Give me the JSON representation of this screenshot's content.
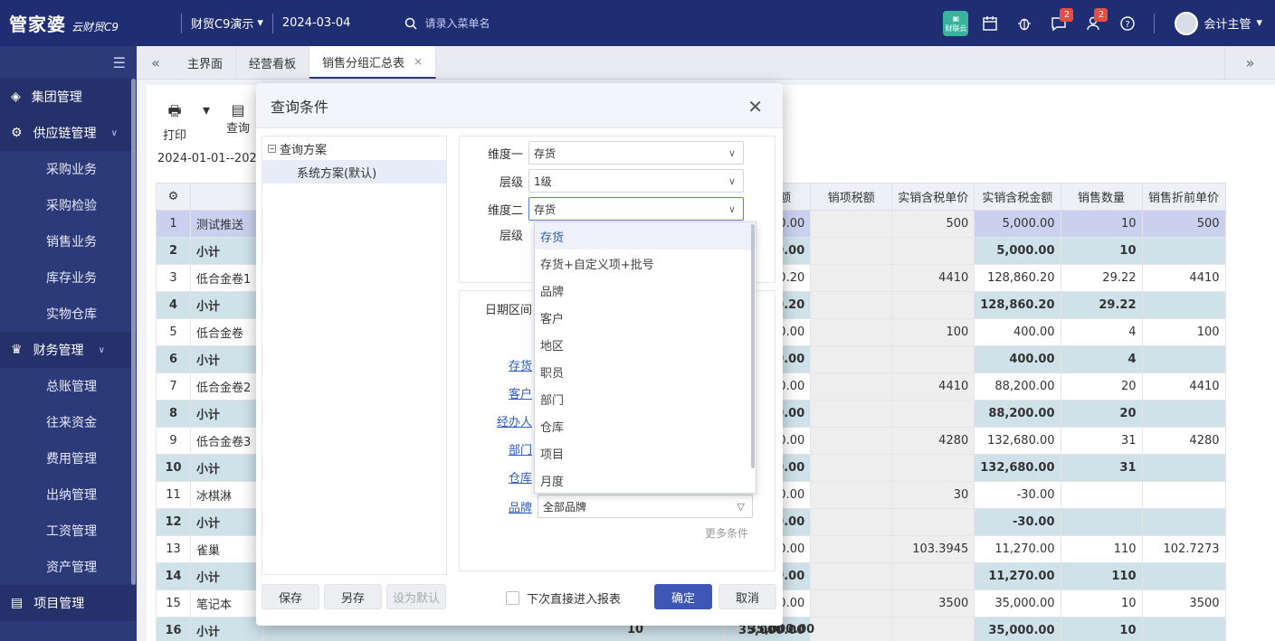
{
  "topbar": {
    "logo_main": "管家婆",
    "logo_sub": "云财贸C9",
    "account": "财贸C9演示",
    "account_caret": "▾",
    "date": "2024-03-04",
    "search_placeholder": "请录入菜单名",
    "app_badge_label": "财联云",
    "msg_badge": "2",
    "user_badge": "2",
    "user_name": "会计主管",
    "user_caret": "▾"
  },
  "sidebar": {
    "groups": [
      {
        "label": "集团管理",
        "items": []
      },
      {
        "label": "供应链管理",
        "items": [
          "采购业务",
          "采购检验",
          "销售业务",
          "库存业务",
          "实物仓库"
        ]
      },
      {
        "label": "财务管理",
        "items": [
          "总账管理",
          "往来资金",
          "费用管理",
          "出纳管理",
          "工资管理",
          "资产管理"
        ]
      },
      {
        "label": "项目管理",
        "items": []
      }
    ]
  },
  "tabs": {
    "items": [
      "主界面",
      "经营看板",
      "销售分组汇总表"
    ],
    "close": "×"
  },
  "toolbar": {
    "print": "打印",
    "query": "查询"
  },
  "report": {
    "daterange": "2024-01-01--202",
    "columns": [
      "",
      "",
      "实销金额",
      "销项税额",
      "实销含税单价",
      "实销含税金额",
      "销售数量",
      "销售折前单价"
    ],
    "rows": [
      {
        "idx": "1",
        "name": "测试推送",
        "amount": "5,000.00",
        "tax": "",
        "price": "500",
        "total": "5,000.00",
        "qty": "10",
        "pre": "500",
        "type": "sel"
      },
      {
        "idx": "2",
        "name": "小计",
        "amount": "5,000.00",
        "tax": "",
        "price": "",
        "total": "5,000.00",
        "qty": "10",
        "pre": "",
        "type": "sub"
      },
      {
        "idx": "3",
        "name": "低合金卷1",
        "amount": "128,860.20",
        "tax": "",
        "price": "4410",
        "total": "128,860.20",
        "qty": "29.22",
        "pre": "4410",
        "type": "odd"
      },
      {
        "idx": "4",
        "name": "小计",
        "amount": "128,860.20",
        "tax": "",
        "price": "",
        "total": "128,860.20",
        "qty": "29.22",
        "pre": "",
        "type": "sub"
      },
      {
        "idx": "5",
        "name": "低合金卷",
        "amount": "400.00",
        "tax": "",
        "price": "100",
        "total": "400.00",
        "qty": "4",
        "pre": "100",
        "type": "odd"
      },
      {
        "idx": "6",
        "name": "小计",
        "amount": "400.00",
        "tax": "",
        "price": "",
        "total": "400.00",
        "qty": "4",
        "pre": "",
        "type": "sub"
      },
      {
        "idx": "7",
        "name": "低合金卷2",
        "amount": "88,200.00",
        "tax": "",
        "price": "4410",
        "total": "88,200.00",
        "qty": "20",
        "pre": "4410",
        "type": "odd"
      },
      {
        "idx": "8",
        "name": "小计",
        "amount": "88,200.00",
        "tax": "",
        "price": "",
        "total": "88,200.00",
        "qty": "20",
        "pre": "",
        "type": "sub"
      },
      {
        "idx": "9",
        "name": "低合金卷3",
        "amount": "132,680.00",
        "tax": "",
        "price": "4280",
        "total": "132,680.00",
        "qty": "31",
        "pre": "4280",
        "type": "odd"
      },
      {
        "idx": "10",
        "name": "小计",
        "amount": "132,680.00",
        "tax": "",
        "price": "",
        "total": "132,680.00",
        "qty": "31",
        "pre": "",
        "type": "sub"
      },
      {
        "idx": "11",
        "name": "冰棋淋",
        "amount": "-30.00",
        "tax": "",
        "price": "30",
        "total": "-30.00",
        "qty": "",
        "pre": "",
        "type": "odd"
      },
      {
        "idx": "12",
        "name": "小计",
        "amount": "-30.00",
        "tax": "",
        "price": "",
        "total": "-30.00",
        "qty": "",
        "pre": "",
        "type": "sub"
      },
      {
        "idx": "13",
        "name": "雀巢",
        "amount": "11,270.00",
        "tax": "",
        "price": "103.3945",
        "total": "11,270.00",
        "qty": "110",
        "pre": "102.7273",
        "type": "odd"
      },
      {
        "idx": "14",
        "name": "小计",
        "amount": "11,270.00",
        "tax": "",
        "price": "",
        "total": "11,270.00",
        "qty": "110",
        "pre": "",
        "type": "sub"
      },
      {
        "idx": "15",
        "name": "笔记本",
        "amount": "35,000.00",
        "tax": "",
        "price": "3500",
        "total": "35,000.00",
        "qty": "10",
        "pre": "3500",
        "type": "odd"
      },
      {
        "idx": "16",
        "name": "小计",
        "amount": "35,000.00",
        "tax": "",
        "price": "",
        "total": "35,000.00",
        "qty": "10",
        "pre": "",
        "type": "sub"
      }
    ],
    "row16_extra_qty": "10",
    "row16_extra_amount": "35,000.00"
  },
  "modal": {
    "title": "查询条件",
    "tree_root": "查询方案",
    "tree_leaf": "系统方案(默认)",
    "dim1_label": "维度一",
    "dim1_value": "存货",
    "level1_label": "层级",
    "level1_value": "1级",
    "dim2_label": "维度二",
    "dim2_value": "存货",
    "level2_label": "层级",
    "date_label": "日期区间",
    "filters": [
      "存货",
      "客户",
      "经办人",
      "部门",
      "仓库"
    ],
    "brand_label": "品牌",
    "brand_value": "全部品牌",
    "more": "更多条件",
    "dropdown": [
      "存货",
      "存货+自定义项+批号",
      "品牌",
      "客户",
      "地区",
      "职员",
      "部门",
      "仓库",
      "项目",
      "月度"
    ],
    "save": "保存",
    "save_as": "另存",
    "set_default": "设为默认",
    "next_time": "下次直接进入报表",
    "ok": "确定",
    "cancel": "取消"
  },
  "colors": {
    "topbar": "#1f2d73",
    "sidebar": "#2c3a7a",
    "primary": "#3e56b5",
    "subtotal_row": "#cfe2ea",
    "selected_row": "#c9d1ef"
  }
}
